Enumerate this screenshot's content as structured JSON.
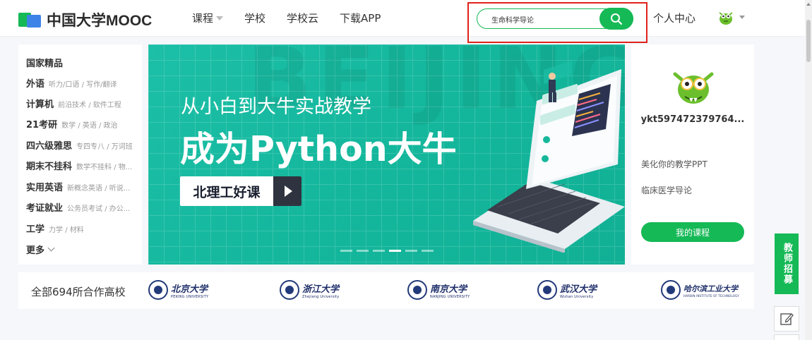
{
  "header": {
    "logo_text": "中国大学MOOC",
    "nav": [
      {
        "label": "课程",
        "has_caret": true
      },
      {
        "label": "学校"
      },
      {
        "label": "学校云"
      },
      {
        "label": "下载APP"
      }
    ],
    "search_value": "生命科学导论",
    "user_center": "个人中心"
  },
  "categories": {
    "title": "国家精品",
    "items": [
      {
        "main": "外语",
        "sub": "听力/口语 / 写作/翻译"
      },
      {
        "main": "计算机",
        "sub": "前沿技术 / 软件工程"
      },
      {
        "main": "21考研",
        "sub": "数学 / 英语 / 政治"
      },
      {
        "main": "四六级雅思",
        "sub": "专四专八 / 万词班"
      },
      {
        "main": "期末不挂科",
        "sub": "数学不挂科 / 物..."
      },
      {
        "main": "实用英语",
        "sub": "新概念英语 / 听说..."
      },
      {
        "main": "考证就业",
        "sub": "公务员考试 / 办公..."
      },
      {
        "main": "工学",
        "sub": "力学 / 材料"
      }
    ],
    "more": "更多"
  },
  "banner": {
    "subtitle": "从小白到大牛实战教学",
    "title": "成为Python大牛",
    "cta": "北理工好课",
    "slides": 6,
    "active_slide": 4
  },
  "user_card": {
    "username": "ykt597472379764...",
    "recent_courses": [
      "美化你的教学PPT",
      "临床医学导论"
    ],
    "my_courses_button": "我的课程"
  },
  "partners": {
    "label": "全部694所合作高校",
    "universities": [
      {
        "name": "北京大学",
        "en": "PEKING UNIVERSITY"
      },
      {
        "name": "浙江大学",
        "en": "Zhejiang University"
      },
      {
        "name": "南京大学",
        "en": "NANJING UNIVERSITY"
      },
      {
        "name": "武汉大学",
        "en": "Wuhan University"
      },
      {
        "name": "哈尔滨工业大学",
        "en": "HARBIN INSTITUTE OF TECHNOLOGY"
      }
    ]
  },
  "sidebar": {
    "recruit_label": "教师招募"
  },
  "colors": {
    "brand_green": "#15b956",
    "highlight_red": "#e0231b",
    "banner_teal": "#14b79c"
  }
}
